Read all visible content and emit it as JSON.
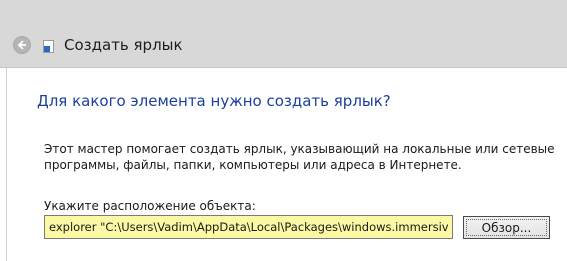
{
  "window": {
    "title": "Создать ярлык"
  },
  "wizard": {
    "heading": "Для какого элемента нужно создать ярлык?",
    "description": "Этот мастер помогает создать ярлык, указывающий на локальные или сетевые программы, файлы, папки, компьютеры или адреса в Интернете.",
    "location_label": "Укажите расположение объекта:",
    "location_value": "explorer \"C:\\Users\\Vadim\\AppData\\Local\\Packages\\windows.immersivecor",
    "browse_label": "Обзор..."
  },
  "icons": {
    "back": "back-arrow-icon",
    "shortcut": "shortcut-icon"
  },
  "colors": {
    "heading": "#1c3f9e",
    "input_background": "#fbf9a3",
    "titlebar": "#d8d8d8"
  }
}
